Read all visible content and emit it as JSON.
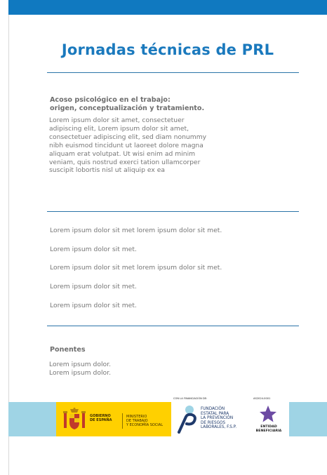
{
  "header": {
    "title": "Jornadas técnicas de PRL"
  },
  "intro": {
    "heading_line1": "Acoso psicológico en el trabajo:",
    "heading_line2": "origen, conceptualización y tratamiento.",
    "body": "Lorem ipsum dolor sit amet, consectetuer adipiscing elit, Lorem ipsum dolor sit amet, consectetuer adipiscing elit, sed diam nonummy nibh euismod tincidunt ut laoreet dolore magna aliquam erat volutpat. Ut wisi enim ad minim veniam, quis nostrud exerci tation ullamcorper suscipit lobortis nisl ut aliquip ex ea"
  },
  "program": {
    "items": [
      "Lorem ipsum dolor sit met lorem ipsum dolor sit met.",
      "Lorem ipsum dolor sit met.",
      "Lorem ipsum dolor sit met lorem ipsum dolor sit met.",
      "Lorem ipsum dolor sit met.",
      "Lorem ipsum dolor sit met."
    ]
  },
  "speakers": {
    "heading": "Ponentes",
    "lines": [
      "Lorem ipsum dolor.",
      "Lorem ipsum dolor."
    ]
  },
  "footer": {
    "government": {
      "line1": "GOBIERNO",
      "line2": "DE ESPAÑA"
    },
    "ministry": {
      "line1": "MINISTERIO",
      "line2": "DE TRABAJO",
      "line3": "Y ECONOMÍA SOCIAL"
    },
    "financing_label": "CON LA FINANCIACIÓN DE:",
    "foundation": {
      "line1": "FUNDACIÓN",
      "line2": "ESTATAL PARA",
      "line3": "LA PREVENCIÓN",
      "line4": "DE RIESGOS",
      "line5": "LABORALES, F.S.P."
    },
    "code": "AS2024-0001",
    "entity": {
      "line1": "ENTIDAD",
      "line2": "BENEFICIARIA"
    }
  },
  "colors": {
    "primary_blue": "#1079c0",
    "light_blue": "#9fd4e5",
    "yellow": "#ffd000",
    "star_purple": "#6c4ba3"
  },
  "icons": [
    "spain-coat-of-arms-icon",
    "foundation-p-logo-icon",
    "star-icon"
  ]
}
